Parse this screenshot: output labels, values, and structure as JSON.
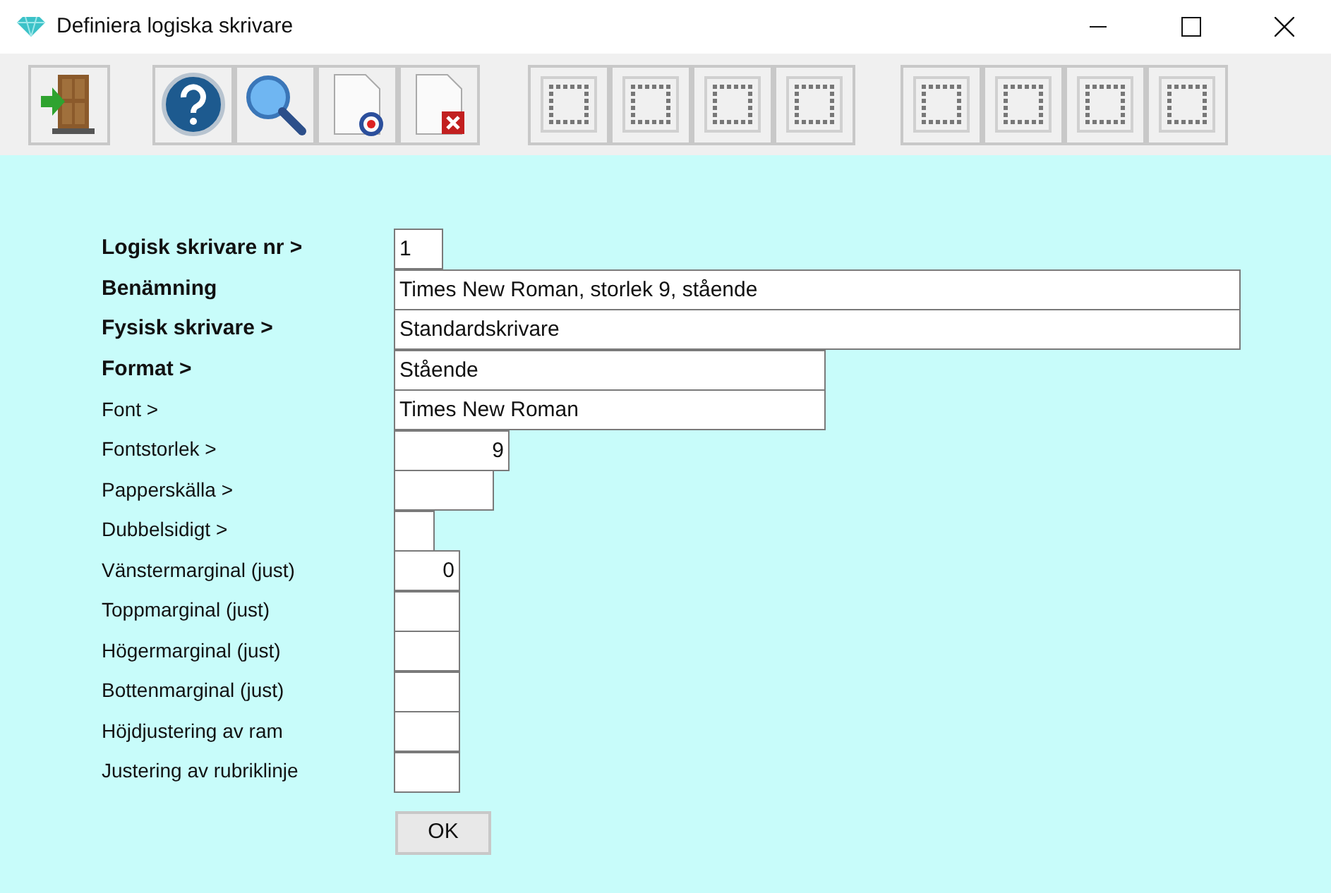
{
  "window": {
    "title": "Definiera logiska skrivare"
  },
  "fields": [
    {
      "label": "Logisk skrivare nr >",
      "required": true,
      "kind": "text",
      "value": "1"
    },
    {
      "label": "Benämning",
      "required": true,
      "kind": "text",
      "value": "Times New Roman, storlek 9, stående"
    },
    {
      "label": "Fysisk skrivare >",
      "required": true,
      "kind": "text",
      "value": "Standardskrivare"
    },
    {
      "label": "Format >",
      "required": true,
      "kind": "text",
      "value": "Stående"
    },
    {
      "label": "Font >",
      "required": false,
      "kind": "text",
      "value": "Times New Roman"
    },
    {
      "label": "Fontstorlek >",
      "required": false,
      "kind": "number",
      "value": "9"
    },
    {
      "label": "Papperskälla >",
      "required": false,
      "kind": "text"
    },
    {
      "label": "Dubbelsidigt >",
      "required": false,
      "kind": "text"
    },
    {
      "label": "Vänstermarginal (just)",
      "required": false,
      "kind": "number",
      "value": "0"
    },
    {
      "label": "Toppmarginal (just)",
      "required": false,
      "kind": "number"
    },
    {
      "label": "Högermarginal (just)",
      "required": false,
      "kind": "number"
    },
    {
      "label": "Bottenmarginal (just)",
      "required": false,
      "kind": "number"
    },
    {
      "label": "Höjdjustering av ram",
      "required": false,
      "kind": "number"
    },
    {
      "label": "Justering av rubriklinje",
      "required": false,
      "kind": "number"
    }
  ],
  "ok_button": "OK"
}
